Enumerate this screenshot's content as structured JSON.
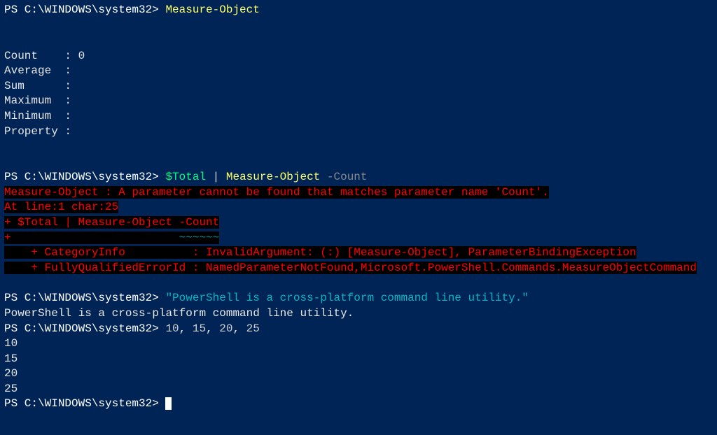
{
  "prompt": "PS C:\\WINDOWS\\system32> ",
  "cmd1": {
    "command": "Measure-Object"
  },
  "output1": {
    "countLabel": "Count    : ",
    "countValue": "0",
    "average": "Average  :",
    "sum": "Sum      :",
    "maximum": "Maximum  :",
    "minimum": "Minimum  :",
    "property": "Property :"
  },
  "cmd2": {
    "var": "$Total",
    "pipe": " | ",
    "command": "Measure-Object",
    "param": " -Count"
  },
  "error": {
    "line1": "Measure-Object : A parameter cannot be found that matches parameter name 'Count'.",
    "line2": "At line:1 char:25",
    "line3": "+ $Total | Measure-Object -Count",
    "line4a": "+                         ",
    "line4b": "~~~~~~",
    "line5": "    + CategoryInfo          : InvalidArgument: (:) [Measure-Object], ParameterBindingException",
    "line6": "    + FullyQualifiedErrorId : NamedParameterNotFound,Microsoft.PowerShell.Commands.MeasureObjectCommand"
  },
  "cmd3": {
    "string": "\"PowerShell is a cross-platform command line utility.\""
  },
  "output3": "PowerShell is a cross-platform command line utility.",
  "cmd4": {
    "n1": "10",
    "n2": "15",
    "n3": "20",
    "n4": "25",
    "sep": ", "
  },
  "output4": {
    "l1": "10",
    "l2": "15",
    "l3": "20",
    "l4": "25"
  }
}
